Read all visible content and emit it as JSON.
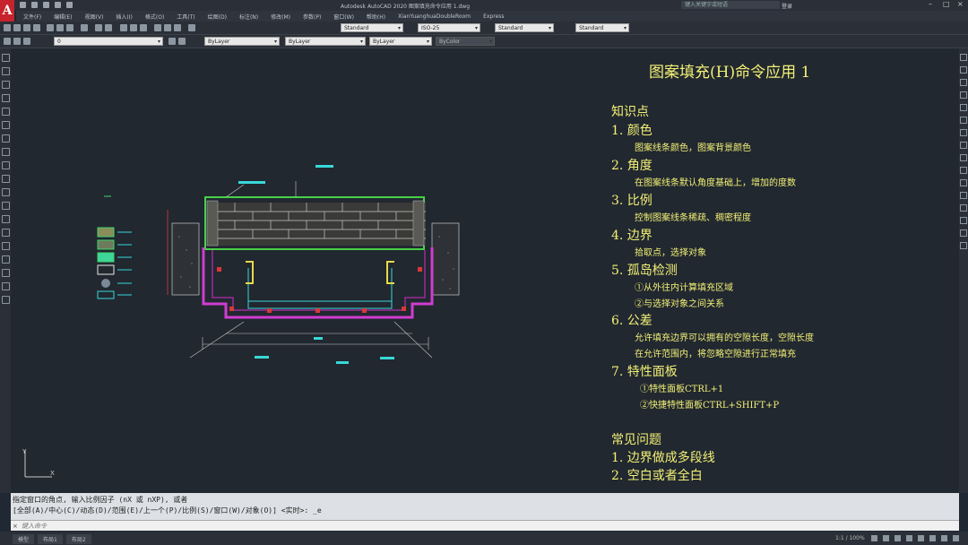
{
  "app": {
    "title": "Autodesk AutoCAD 2020   图案填充命令应用 1.dwg",
    "logo": "A"
  },
  "search": {
    "placeholder": "键入关键字或短语"
  },
  "user": {
    "name": "登录"
  },
  "menu": [
    "文件(F)",
    "编辑(E)",
    "视图(V)",
    "插入(I)",
    "格式(O)",
    "工具(T)",
    "绘图(D)",
    "标注(N)",
    "修改(M)",
    "参数(P)",
    "窗口(W)",
    "帮助(H)",
    "XianYuanghuaDoubleRoom",
    "Express"
  ],
  "toolbar": {
    "layer": "0",
    "text_style": "Standard",
    "dim_style": "ISO-25",
    "table_style": "Standard",
    "mleader_style": "Standard",
    "color": "ByLayer",
    "linetype": "ByLayer",
    "lineweight": "ByLayer",
    "plotstyle": "ByColor"
  },
  "notes": {
    "title": "图案填充(H)命令应用 1",
    "section1_header": "知识点",
    "items": [
      {
        "head": "1. 颜色",
        "sub": [
          "图案线条颜色，图案背景颜色"
        ]
      },
      {
        "head": "2. 角度",
        "sub": [
          "在图案线条默认角度基础上，增加的度数"
        ]
      },
      {
        "head": "3. 比例",
        "sub": [
          "控制图案线条稀疏、稠密程度"
        ]
      },
      {
        "head": "4. 边界",
        "sub": [
          "拾取点，选择对象"
        ]
      },
      {
        "head": "5. 孤岛检测",
        "sub": [
          "①从外往内计算填充区域",
          "②与选择对象之间关系"
        ]
      },
      {
        "head": "6. 公差",
        "sub": [
          "允许填充边界可以拥有的空隙长度，空隙长度",
          "在允许范围内，将忽略空隙进行正常填充"
        ]
      },
      {
        "head": "7. 特性面板",
        "sub": [
          "①特性面板CTRL+1",
          "②快捷特性面板CTRL+SHIFT+P"
        ]
      }
    ],
    "section2_header": "常见问题",
    "faq": [
      "1. 边界做成多段线",
      "2. 空白或者全白"
    ]
  },
  "command": {
    "line1": "指定窗口的角点, 输入比例因子 (nX 或 nXP), 或者",
    "line2": "[全部(A)/中心(C)/动态(D)/范围(E)/上一个(P)/比例(S)/窗口(W)/对象(O)] <实时>: _e",
    "input_placeholder": "键入命令"
  },
  "status": {
    "tabs": [
      "模型",
      "布局1",
      "布局2"
    ],
    "scale": "1:1 / 100%"
  },
  "colors": {
    "accent_text": "#f3f075",
    "canvas": "#212830",
    "magenta": "#d13cd1",
    "green": "#48d148",
    "cyan": "#38d8d8"
  }
}
